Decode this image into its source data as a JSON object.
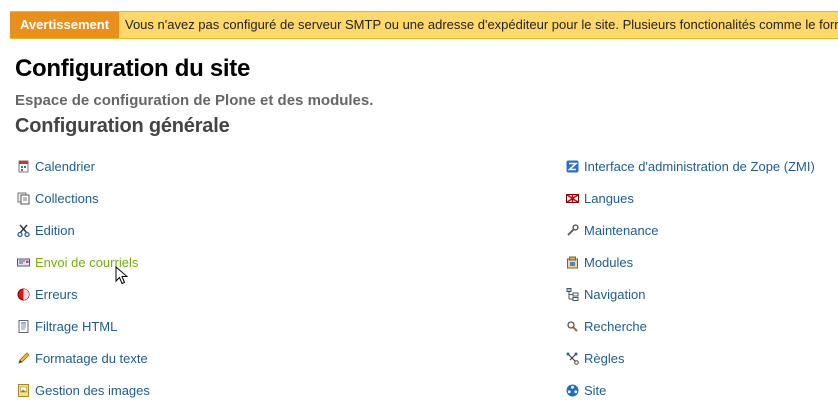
{
  "warning": {
    "label": "Avertissement",
    "message": "Vous n'avez pas configuré de serveur SMTP ou une adresse d'expéditeur pour le site. Plusieurs fonctionalités comme le formulaire"
  },
  "page": {
    "title": "Configuration du site",
    "description": "Espace de configuration de Plone et des modules.",
    "section_title": "Configuration générale"
  },
  "left_items": [
    {
      "label": "Calendrier",
      "icon": "calendar-icon"
    },
    {
      "label": "Collections",
      "icon": "collections-icon"
    },
    {
      "label": "Edition",
      "icon": "scissors-icon"
    },
    {
      "label": "Envoi de courriels",
      "icon": "mail-icon"
    },
    {
      "label": "Erreurs",
      "icon": "error-icon"
    },
    {
      "label": "Filtrage HTML",
      "icon": "html-filter-icon"
    },
    {
      "label": "Formatage du texte",
      "icon": "pencil-icon"
    },
    {
      "label": "Gestion des images",
      "icon": "image-icon"
    }
  ],
  "right_items": [
    {
      "label": "Interface d'administration de Zope (ZMI)",
      "icon": "zope-icon"
    },
    {
      "label": "Langues",
      "icon": "flag-icon"
    },
    {
      "label": "Maintenance",
      "icon": "wrench-icon"
    },
    {
      "label": "Modules",
      "icon": "modules-icon"
    },
    {
      "label": "Navigation",
      "icon": "sitemap-icon"
    },
    {
      "label": "Recherche",
      "icon": "search-icon"
    },
    {
      "label": "Règles",
      "icon": "rules-icon"
    },
    {
      "label": "Site",
      "icon": "site-icon"
    }
  ],
  "colors": {
    "link": "#205c90",
    "link_hover": "#74ae0b",
    "warning_bg": "#ffd86b",
    "warning_tag": "#e8901b"
  }
}
